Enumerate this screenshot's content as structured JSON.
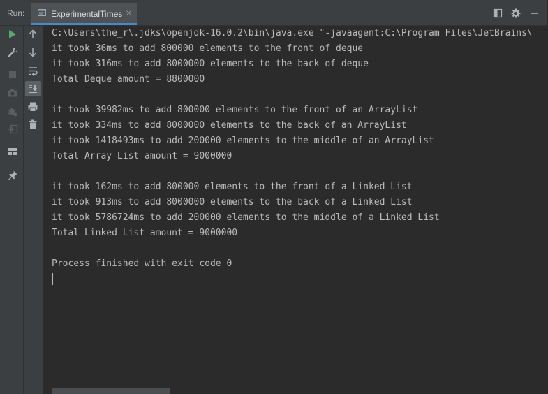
{
  "header": {
    "run_label": "Run:",
    "tab_label": "ExperimentalTimes"
  },
  "colors": {
    "background": "#2b2b2b",
    "toolbar": "#3c3f41",
    "tab_active": "#4e5254",
    "tab_underline": "#4a88c7",
    "run_green": "#59a869",
    "console_text": "#bbbbbb"
  },
  "icons": {
    "header": [
      "layout-icon",
      "gear-icon",
      "minimize-icon"
    ],
    "gutter_left": [
      "run-icon",
      "wrench-icon",
      "stop-icon",
      "camera-icon",
      "debug-bug-icon",
      "exit-icon",
      "layout-panels-icon",
      "pin-icon"
    ],
    "gutter_right": [
      "arrow-up-icon",
      "arrow-down-icon",
      "soft-wrap-icon",
      "scroll-to-end-icon",
      "print-icon",
      "trash-icon"
    ]
  },
  "console": {
    "lines": [
      "C:\\Users\\the_r\\.jdks\\openjdk-16.0.2\\bin\\java.exe \"-javaagent:C:\\Program Files\\JetBrains\\",
      "it took 36ms to add 800000 elements to the front of deque",
      "it took 316ms to add 8000000 elements to the back of deque",
      "Total Deque amount = 8800000",
      "",
      "it took 39982ms to add 800000 elements to the front of an ArrayList",
      "it took 334ms to add 8000000 elements to the back of an ArrayList",
      "it took 1418493ms to add 200000 elements to the middle of an ArrayList",
      "Total Array List amount = 9000000",
      "",
      "it took 162ms to add 800000 elements to the front of a Linked List",
      "it took 913ms to add 8000000 elements to the back of a Linked List",
      "it took 5786724ms to add 200000 elements to the middle of a Linked List",
      "Total Linked List amount = 9000000",
      "",
      "Process finished with exit code 0"
    ]
  }
}
